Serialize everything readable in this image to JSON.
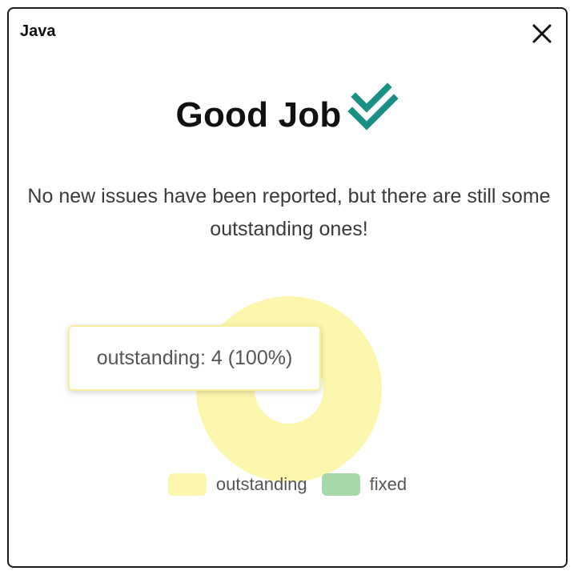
{
  "card": {
    "title": "Java",
    "close_icon": "close-icon"
  },
  "headline": {
    "text": "Good Job",
    "icon": "double-check-icon",
    "icon_color": "#1a8f84"
  },
  "message": "No new issues have been reported, but there are still some outstanding ones!",
  "tooltip": {
    "text": "outstanding: 4 (100%)"
  },
  "chart_data": {
    "type": "pie",
    "categories": [
      "outstanding",
      "fixed"
    ],
    "values": [
      4,
      0
    ],
    "colors": [
      "#fdf7ae",
      "#a7d8a9"
    ],
    "legend_position": "bottom"
  },
  "legend": {
    "items": [
      {
        "label": "outstanding",
        "color": "#fdf7ae"
      },
      {
        "label": "fixed",
        "color": "#a7d8a9"
      }
    ]
  }
}
